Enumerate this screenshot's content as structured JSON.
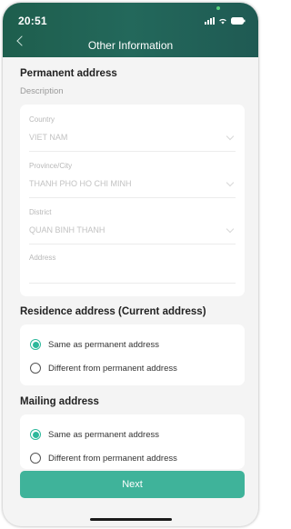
{
  "status_bar": {
    "time": "20:51"
  },
  "header": {
    "title": "Other Information"
  },
  "permanent": {
    "title": "Permanent address",
    "description": "Description",
    "fields": [
      {
        "label": "Country",
        "value": "VIET NAM"
      },
      {
        "label": "Province/City",
        "value": "THANH PHO HO CHI MINH"
      },
      {
        "label": "District",
        "value": "QUAN BINH THANH"
      },
      {
        "label": "Address",
        "value": ""
      }
    ]
  },
  "residence": {
    "title": "Residence address (Current address)",
    "options": [
      {
        "label": "Same as permanent address",
        "selected": true
      },
      {
        "label": "Different from permanent address",
        "selected": false
      }
    ]
  },
  "mailing": {
    "title": "Mailing address",
    "options": [
      {
        "label": "Same as permanent address",
        "selected": true
      },
      {
        "label": "Different from permanent address",
        "selected": false
      }
    ]
  },
  "next_label": "Next",
  "colors": {
    "header": "#1f5f50",
    "accent": "#3fb39a",
    "background": "#f4f4f4"
  }
}
